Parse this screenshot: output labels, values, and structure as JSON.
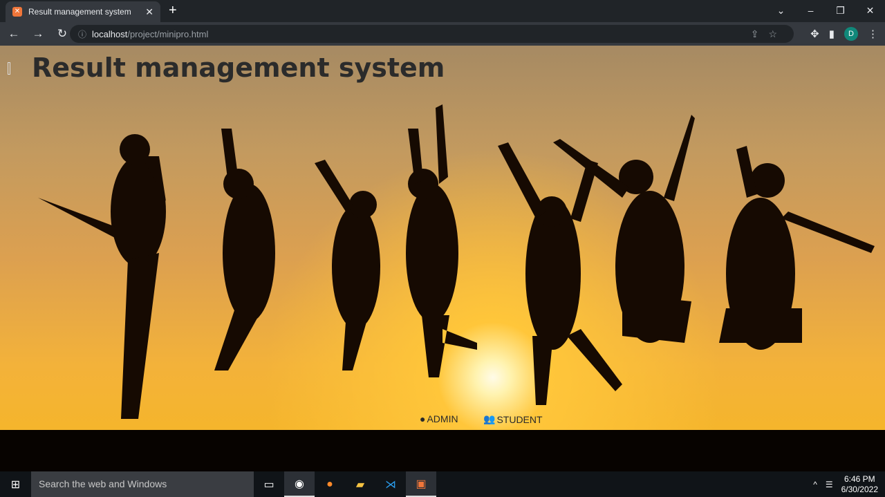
{
  "browser": {
    "tab_title": "Result management system",
    "url_host": "localhost",
    "url_path": "/project/minipro.html",
    "profile_initial": "D"
  },
  "page": {
    "title": "Result management system",
    "nav": [
      {
        "label": "ADMIN",
        "icon": "user-circle-icon"
      },
      {
        "label": "STUDENT",
        "icon": "users-icon"
      }
    ]
  },
  "taskbar": {
    "search_placeholder": "Search the web and Windows",
    "time": "6:46 PM",
    "date": "6/30/2022"
  }
}
